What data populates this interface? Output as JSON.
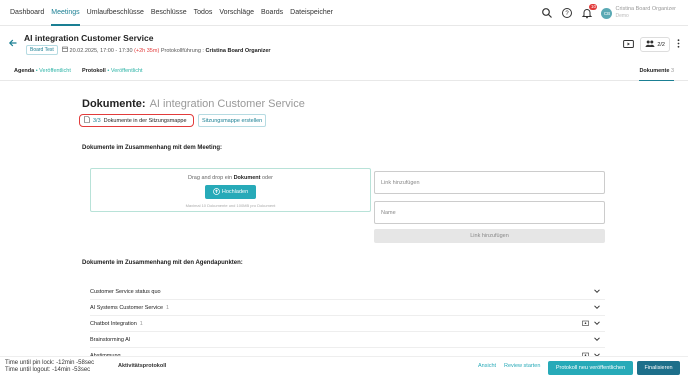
{
  "nav": {
    "items": [
      "Dashboard",
      "Meetings",
      "Umlaufbeschlüsse",
      "Beschlüsse",
      "Todos",
      "Vorschläge",
      "Boards",
      "Dateispeicher"
    ],
    "active_index": 1
  },
  "topright": {
    "notification_count": "10",
    "avatar_initials": "CB",
    "user_name": "Cristina Board Organizer",
    "user_role": "Demo"
  },
  "meeting": {
    "title": "AI integration Customer Service",
    "tag": "Board Test",
    "date": "20.02.2025, 17:00 - 17:30",
    "overtime": "(+2h 35m)",
    "protokoll_label": "Protokollführung :",
    "protokoll_person": "Cristina Board Organizer",
    "participants": "2/2"
  },
  "subnav": {
    "agenda_label": "Agenda",
    "agenda_status": "Veröffentlicht",
    "protokoll_label": "Protokoll",
    "protokoll_status": "Veröffentlicht",
    "dokumente_label": "Dokumente",
    "dokumente_count": "3"
  },
  "main": {
    "title_label": "Dokumente:",
    "title_meeting": "AI integration Customer Service",
    "mappe_count": "3/3",
    "mappe_text": "Dokumente in der Sitzungsmappe",
    "mappe_create": "Sitzungsmappe erstellen",
    "section_meeting": "Dokumente im Zusammenhang mit dem Meeting:",
    "drop_prefix": "Drag and drop ein",
    "drop_bold": "Dokument",
    "drop_suffix": "oder",
    "upload_label": "Hochladen",
    "drop_hint": "Maximal 10 Dokumente und 100MB pro Dokument",
    "link_placeholder": "Link hinzufügen",
    "name_placeholder": "Name",
    "link_button": "Link hinzufügen",
    "section_agenda": "Dokumente im Zusammenhang mit den Agendapunkten:",
    "agenda_items": [
      {
        "label": "Customer Service status quo",
        "count": ""
      },
      {
        "label": "AI Systems Customer Service",
        "count": "1"
      },
      {
        "label": "Chatbot Integration",
        "count": "1"
      },
      {
        "label": "Brainstorming AI",
        "count": ""
      },
      {
        "label": "Abstimmung",
        "count": ""
      }
    ]
  },
  "bottom": {
    "pin_lock_label": "Time until pin lock:",
    "pin_lock_value": "-12min -58sec",
    "logout_label": "Time until logout:",
    "logout_value": "-14min -53sec",
    "aktivitaet": "Aktivitätsprotokoll",
    "ansicht": "Ansicht",
    "review": "Review starten",
    "publish": "Protokoll neu veröffentlichen",
    "finalize": "Finalisieren"
  },
  "colors": {
    "accent": "#1a7f93",
    "published": "#2bb3a6",
    "button": "#27aab8",
    "alert": "#e23b3b"
  }
}
